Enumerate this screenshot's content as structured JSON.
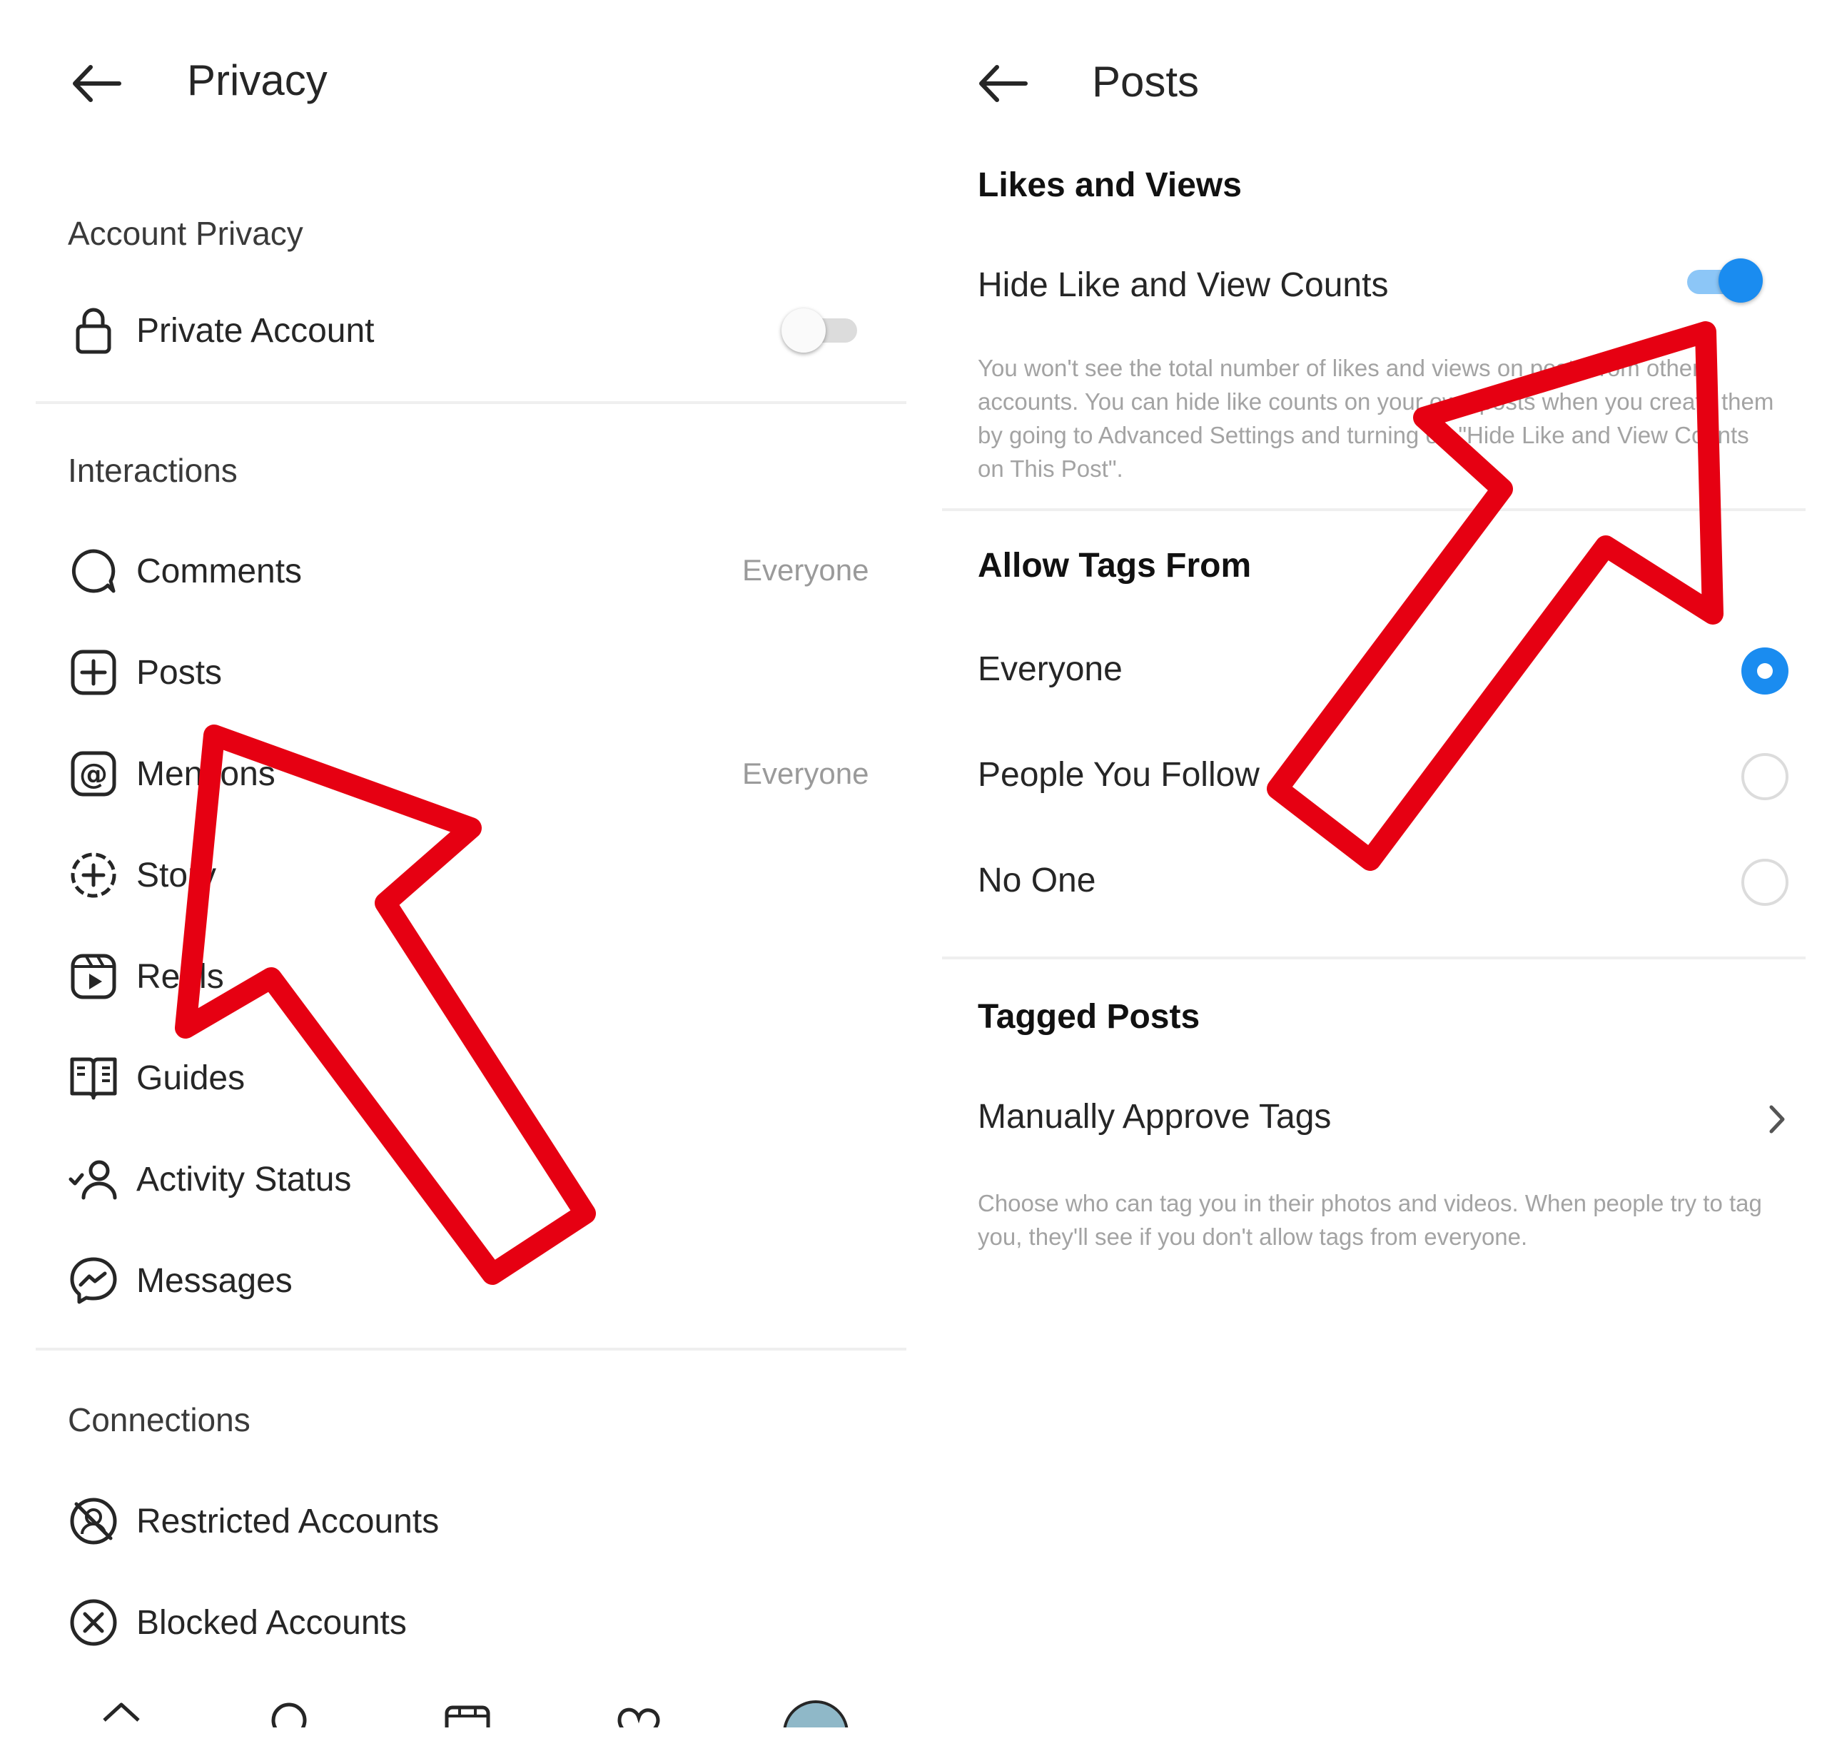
{
  "left": {
    "title": "Privacy",
    "account_privacy": {
      "heading": "Account Privacy",
      "private_account_label": "Private Account",
      "private_account_on": false
    },
    "interactions": {
      "heading": "Interactions",
      "items": [
        {
          "label": "Comments",
          "value": "Everyone",
          "icon": "comment-bubble-icon"
        },
        {
          "label": "Posts",
          "value": "",
          "icon": "plus-square-icon"
        },
        {
          "label": "Mentions",
          "value": "Everyone",
          "icon": "at-sign-icon"
        },
        {
          "label": "Story",
          "value": "",
          "icon": "story-plus-icon"
        },
        {
          "label": "Reels",
          "value": "",
          "icon": "reels-icon"
        },
        {
          "label": "Guides",
          "value": "",
          "icon": "guides-book-icon"
        },
        {
          "label": "Activity Status",
          "value": "",
          "icon": "activity-status-icon"
        },
        {
          "label": "Messages",
          "value": "",
          "icon": "messenger-icon"
        }
      ]
    },
    "connections": {
      "heading": "Connections",
      "items": [
        {
          "label": "Restricted Accounts",
          "icon": "restricted-icon"
        },
        {
          "label": "Blocked Accounts",
          "icon": "blocked-x-icon"
        }
      ]
    },
    "bottom_nav": [
      "home-icon",
      "search-icon",
      "shop-icon",
      "heart-icon",
      "profile-avatar-icon"
    ]
  },
  "right": {
    "title": "Posts",
    "likes_views": {
      "heading": "Likes and Views",
      "toggle_label": "Hide Like and View Counts",
      "toggle_on": true,
      "description": "You won't see the total number of likes and views on posts from other accounts. You can hide like counts on your own posts when you create them by going to Advanced Settings and turning on \"Hide Like and View Counts on This Post\"."
    },
    "allow_tags": {
      "heading": "Allow Tags From",
      "options": [
        "Everyone",
        "People You Follow",
        "No One"
      ],
      "selected": "Everyone"
    },
    "tagged_posts": {
      "heading": "Tagged Posts",
      "manual_label": "Manually Approve Tags",
      "description": "Choose who can tag you in their photos and videos. When people try to tag you, they'll see if you don't allow tags from everyone."
    }
  },
  "annotation": {
    "arrow_color": "#e60012"
  },
  "colors": {
    "accent": "#1a8cf0",
    "text": "#262626",
    "muted": "#9a9a9a",
    "divider": "#efefef"
  }
}
